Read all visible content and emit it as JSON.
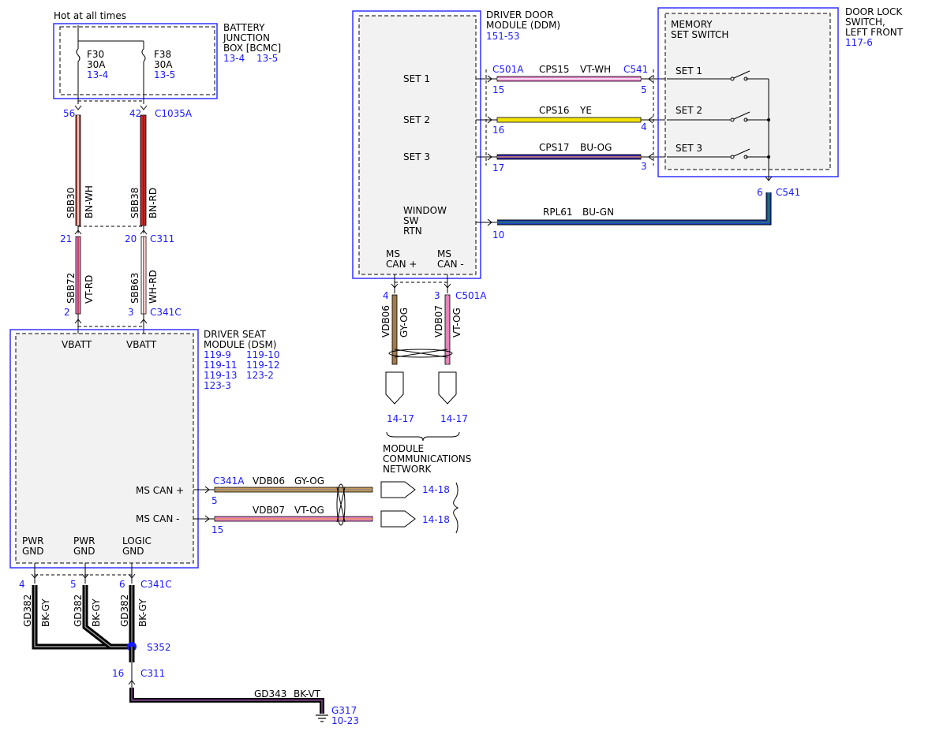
{
  "colors": {
    "pink": "#e47fc6",
    "yellow": "#f2e200",
    "navy": "#2b1fa6",
    "blue": "#1f3fc8",
    "brown_red": "#b04a3a",
    "red": "#c62828",
    "tan": "#a07c4c",
    "gy_og": "#c89a58",
    "black": "#000000",
    "bk_vt": "#4a2a4a",
    "splice": "#1a1aff"
  },
  "top": {
    "hot_label": "Hot at all times"
  },
  "bcmc": {
    "lines": [
      "BATTERY",
      "JUNCTION",
      "BOX [BCMC]"
    ],
    "refs": [
      "13-4",
      "13-5"
    ],
    "fuse1": {
      "name": "F30",
      "rating": "30A",
      "ref": "13-4"
    },
    "fuse2": {
      "name": "F38",
      "rating": "30A",
      "ref": "13-5"
    }
  },
  "c1035a": {
    "pin1": "56",
    "pin2": "42",
    "name": "C1035A"
  },
  "wires_top": {
    "w1_circuit": "SBB30",
    "w1_color": "BN-WH",
    "w2_circuit": "SBB38",
    "w2_color": "BN-RD"
  },
  "c311_top": {
    "pin1": "21",
    "pin2": "20",
    "name": "C311"
  },
  "wires_mid": {
    "w1_circuit": "SBB72",
    "w1_color": "VT-RD",
    "w2_circuit": "SBB63",
    "w2_color": "WH-RD"
  },
  "c341c_top": {
    "pin1": "2",
    "pin2": "3",
    "name": "C341C"
  },
  "dsm": {
    "lines": [
      "DRIVER SEAT",
      "MODULE (DSM)"
    ],
    "refs": [
      [
        "119-9",
        "119-10"
      ],
      [
        "119-11",
        "119-12"
      ],
      [
        "119-13",
        "123-2"
      ],
      [
        "123-3",
        ""
      ]
    ],
    "vbatt1": "VBATT",
    "vbatt2": "VBATT",
    "ms_can_plus": "MS CAN +",
    "ms_can_minus": "MS CAN -",
    "pwr_gnd1": [
      "PWR",
      "GND"
    ],
    "pwr_gnd2": [
      "PWR",
      "GND"
    ],
    "logic_gnd": [
      "LOGIC",
      "GND"
    ]
  },
  "ddm": {
    "lines": [
      "DRIVER DOOR",
      "MODULE (DDM)"
    ],
    "ref": "151-53",
    "set1": "SET 1",
    "set2": "SET 2",
    "set3": "SET 3",
    "window": [
      "WINDOW",
      "SW",
      "RTN"
    ],
    "ms_can_plus": [
      "MS",
      "CAN +"
    ],
    "ms_can_minus": [
      "MS",
      "CAN -"
    ]
  },
  "memory": {
    "title_lines": [
      "DOOR LOCK",
      "SWITCH,",
      "LEFT FRONT"
    ],
    "ref": "117-6",
    "inner_lines": [
      "MEMORY",
      "SET SWITCH"
    ],
    "set1": "SET 1",
    "set2": "SET 2",
    "set3": "SET 3"
  },
  "ddm_wires": {
    "c501a": "C501A",
    "c541": "C541",
    "w1": {
      "circuit": "CPS15",
      "color": "VT-WH",
      "pin_left": "15",
      "pin_right": "5"
    },
    "w2": {
      "circuit": "CPS16",
      "color": "YE",
      "pin_left": "16",
      "pin_right": "4"
    },
    "w3": {
      "circuit": "CPS17",
      "color": "BU-OG",
      "pin_left": "17",
      "pin_right": "3"
    },
    "w4": {
      "circuit": "RPL61",
      "color": "BU-GN",
      "pin_left": "10",
      "pin_right": "6",
      "conn": "C541"
    }
  },
  "ddm_can": {
    "pin1": "4",
    "pin2": "3",
    "conn": "C501A",
    "w1_circuit": "VDB06",
    "w1_color": "GY-OG",
    "w2_circuit": "VDB07",
    "w2_color": "VT-OG",
    "ref1": "14-17",
    "ref2": "14-17"
  },
  "network": {
    "lines": [
      "MODULE",
      "COMMUNICATIONS",
      "NETWORK"
    ]
  },
  "dsm_can": {
    "conn": "C341A",
    "w1": {
      "pin": "5",
      "circuit": "VDB06",
      "color": "GY-OG",
      "ref": "14-18"
    },
    "w2": {
      "pin": "15",
      "circuit": "VDB07",
      "color": "VT-OG",
      "ref": "14-18"
    }
  },
  "grounds": {
    "pin1": "4",
    "pin2": "5",
    "pin3": "6",
    "conn": "C341C",
    "circuit": "GD382",
    "color": "BK-GY",
    "splice": "S352",
    "c311_pin": "16",
    "c311": "C311",
    "gd343": "GD343",
    "gd343_color": "BK-VT",
    "ground_name": "G317",
    "ground_ref": "10-23"
  }
}
